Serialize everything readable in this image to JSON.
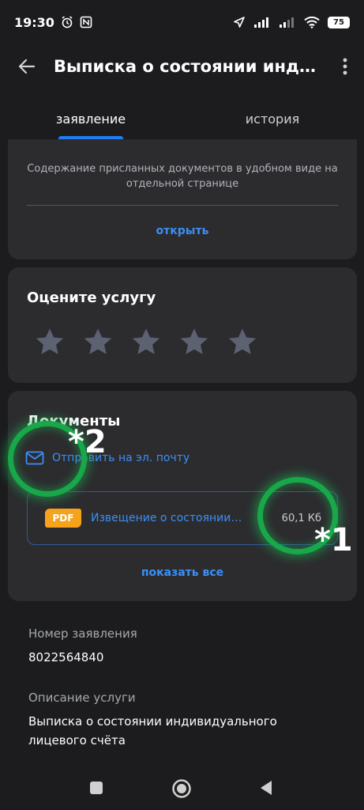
{
  "status_bar": {
    "time": "19:30",
    "battery": "75"
  },
  "app_bar": {
    "title": "Выписка о состоянии индив..."
  },
  "tabs": [
    {
      "label": "заявление",
      "active": true
    },
    {
      "label": "история",
      "active": false
    }
  ],
  "document_card": {
    "description": "Содержание присланных документов в удобном виде на отдельной странице",
    "open_link": "открыть"
  },
  "rating_card": {
    "title": "Оцените услугу",
    "stars_total": 5,
    "stars_selected": 0
  },
  "documents_card": {
    "title": "Документы",
    "email_link": "Отправить на эл. почту",
    "file": {
      "badge": "PDF",
      "name": "Извещение о состоянии ин...",
      "size": "60,1 Кб"
    },
    "show_all": "показать все"
  },
  "annotations": {
    "label_1": "*1",
    "label_2": "*2",
    "color": "#18a84a"
  },
  "info": {
    "application_number_label": "Номер заявления",
    "application_number": "8022564840",
    "service_description_label": "Описание услуги",
    "service_description": "Выписка о состоянии индивидуального лицевого счёта"
  },
  "colors": {
    "background": "#1c1c1e",
    "card": "#2c2c2f",
    "accent": "#3b8ff5",
    "pdf_badge": "#f7a21b",
    "star": "#5c6272"
  }
}
